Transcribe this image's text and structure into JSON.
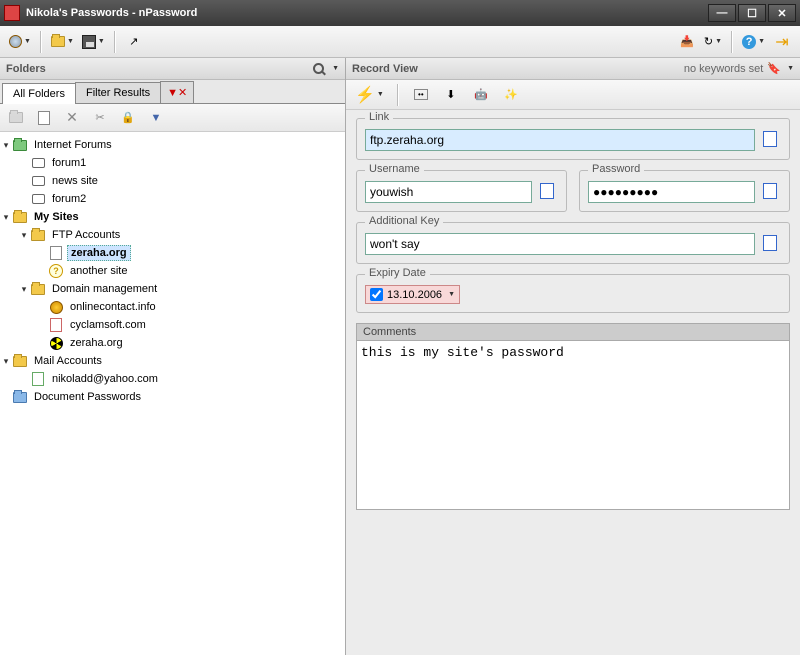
{
  "window": {
    "title": "Nikola's Passwords - nPassword"
  },
  "panes": {
    "folders_title": "Folders",
    "record_title": "Record View",
    "keywords_status": "no keywords set"
  },
  "tabs": {
    "all": "All Folders",
    "filter": "Filter Results"
  },
  "tree": [
    {
      "depth": 0,
      "toggle": "▾",
      "icon": "folder-green",
      "label": "Internet Forums"
    },
    {
      "depth": 1,
      "toggle": "",
      "icon": "chat",
      "label": "forum1"
    },
    {
      "depth": 1,
      "toggle": "",
      "icon": "chat",
      "label": "news site"
    },
    {
      "depth": 1,
      "toggle": "",
      "icon": "chat",
      "label": "forum2"
    },
    {
      "depth": 0,
      "toggle": "▾",
      "icon": "folder",
      "label": "My Sites",
      "bold": true
    },
    {
      "depth": 1,
      "toggle": "▾",
      "icon": "folder",
      "label": "FTP Accounts"
    },
    {
      "depth": 2,
      "toggle": "",
      "icon": "page",
      "label": "zeraha.org",
      "selected": true
    },
    {
      "depth": 2,
      "toggle": "",
      "icon": "question",
      "label": "another site"
    },
    {
      "depth": 1,
      "toggle": "▾",
      "icon": "folder",
      "label": "Domain management"
    },
    {
      "depth": 2,
      "toggle": "",
      "icon": "gear",
      "label": "onlinecontact.info"
    },
    {
      "depth": 2,
      "toggle": "",
      "icon": "page-red",
      "label": "cyclamsoft.com"
    },
    {
      "depth": 2,
      "toggle": "",
      "icon": "rad",
      "label": "zeraha.org"
    },
    {
      "depth": 0,
      "toggle": "▾",
      "icon": "folder",
      "label": "Mail Accounts"
    },
    {
      "depth": 1,
      "toggle": "",
      "icon": "page-green",
      "label": "nikoladd@yahoo.com"
    },
    {
      "depth": 0,
      "toggle": "",
      "icon": "folder-blue",
      "label": "Document Passwords"
    }
  ],
  "record": {
    "link_label": "Link",
    "link_value": "ftp.zeraha.org",
    "username_label": "Username",
    "username_value": "youwish",
    "password_label": "Password",
    "password_value": "●●●●●●●●●",
    "addkey_label": "Additional Key",
    "addkey_value": "won't say",
    "expiry_label": "Expiry Date",
    "expiry_value": "13.10.2006",
    "comments_label": "Comments",
    "comments_value": "this is my site's password"
  }
}
